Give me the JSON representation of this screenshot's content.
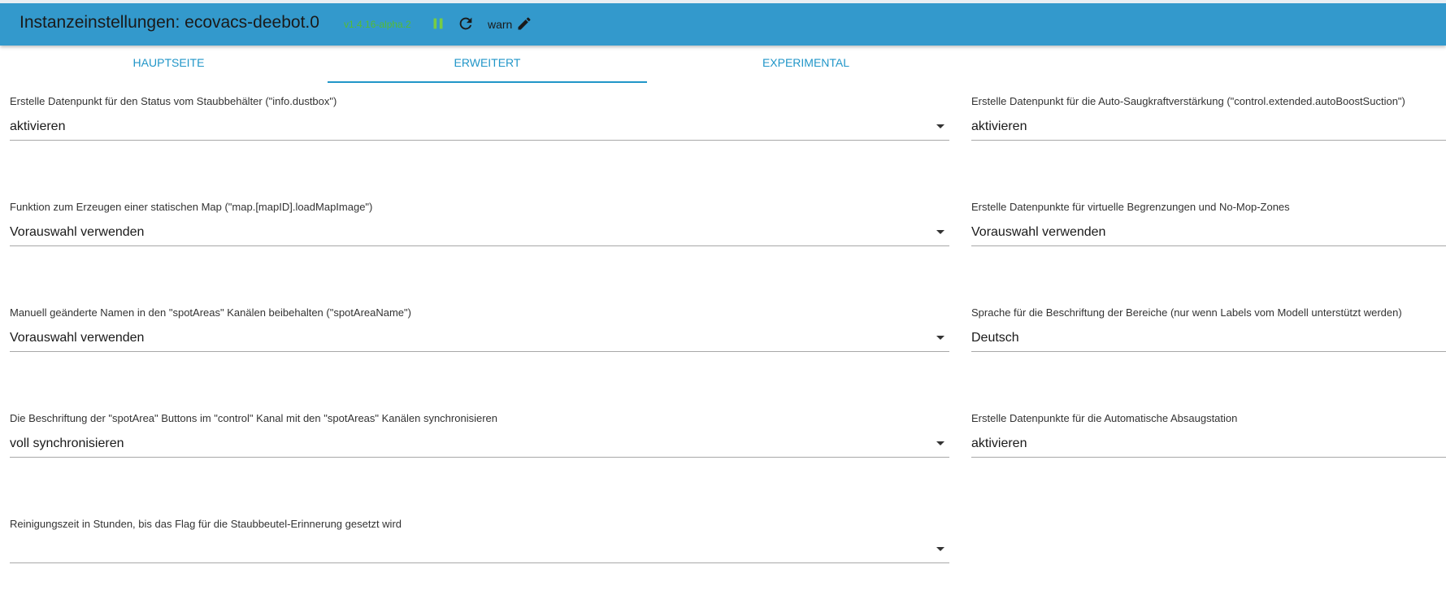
{
  "header": {
    "title": "Instanzeinstellungen: ecovacs-deebot.0",
    "version": "v1.4.16-alpha.2",
    "log_level": "warn",
    "icons": {
      "pause": "pause-icon",
      "refresh": "refresh-icon",
      "edit": "pencil-icon"
    },
    "colors": {
      "bar": "#3399cc",
      "version": "#55bb33",
      "pause": "#77cc44"
    }
  },
  "tabs": [
    {
      "label": "HAUPTSEITE",
      "active": false
    },
    {
      "label": "ERWEITERT",
      "active": true
    },
    {
      "label": "EXPERIMENTAL",
      "active": false
    }
  ],
  "fields_left": [
    {
      "label": "Erstelle Datenpunkt für den Status vom Staubbehälter (\"info.dustbox\")",
      "value": "aktivieren"
    },
    {
      "label": "Funktion zum Erzeugen einer statischen Map (\"map.[mapID].loadMapImage\")",
      "value": "Vorauswahl verwenden"
    },
    {
      "label": "Manuell geänderte Namen in den \"spotAreas\" Kanälen beibehalten (\"spotAreaName\")",
      "value": "Vorauswahl verwenden"
    },
    {
      "label": "Die Beschriftung der \"spotArea\" Buttons im \"control\" Kanal mit den \"spotAreas\" Kanälen synchronisieren",
      "value": "voll synchronisieren"
    },
    {
      "label": "Reinigungszeit in Stunden, bis das Flag für die Staubbeutel-Erinnerung gesetzt wird",
      "value": ""
    }
  ],
  "fields_right": [
    {
      "label": "Erstelle Datenpunkt für die Auto-Saugkraftverstärkung (\"control.extended.autoBoostSuction\")",
      "value": "aktivieren"
    },
    {
      "label": "Erstelle Datenpunkte für virtuelle Begrenzungen und No-Mop-Zones",
      "value": "Vorauswahl verwenden"
    },
    {
      "label": "Sprache für die Beschriftung der Bereiche (nur wenn Labels vom Modell unterstützt werden)",
      "value": "Deutsch"
    },
    {
      "label": "Erstelle Datenpunkte für die Automatische Absaugstation",
      "value": "aktivieren"
    }
  ]
}
